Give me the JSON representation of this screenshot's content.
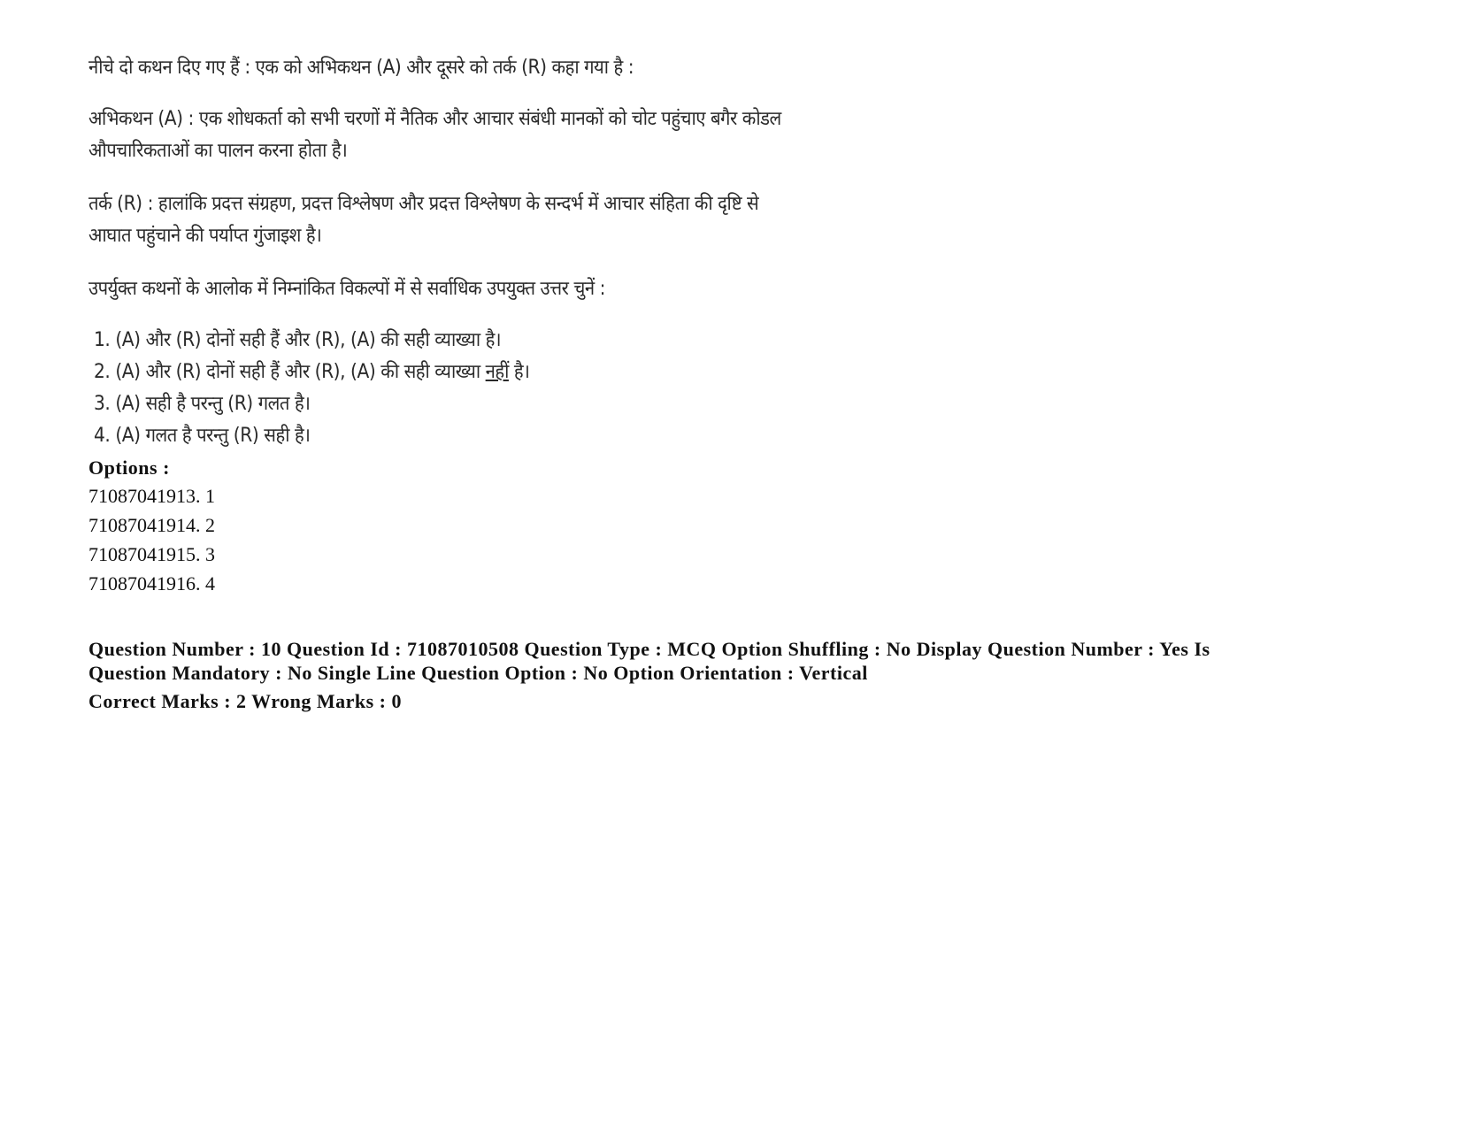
{
  "question": {
    "intro": "नीचे दो कथन दिए गए हैं : एक को अभिकथन (A) और दूसरे को तर्क (R) कहा गया है :",
    "assertion_line1": "अभिकथन (A) : एक शोधकर्ता को सभी चरणों में नैतिक और आचार संबंधी मानकों को चोट पहुंचाए बगैर कोडल",
    "assertion_line2": "औपचारिकताओं का पालन करना होता है।",
    "reason_line1": "तर्क (R) : हालांकि प्रदत्त संग्रहण, प्रदत्त विश्लेषण और प्रदत्त विश्लेषण के सन्दर्भ में आचार संहिता की दृष्टि से",
    "reason_line2": "आघात पहुंचाने की पर्याप्त गुंजाइश है।",
    "instruction": "उपर्युक्त कथनों के आलोक में निम्नांकित विकल्पों में से सर्वाधिक उपयुक्त उत्तर चुनें :",
    "choices": [
      {
        "text": "1. (A) और (R) दोनों सही हैं और (R), (A) की सही व्याख्या है।"
      },
      {
        "text_before": "2. (A) और (R) दोनों सही हैं और (R), (A) की सही व्याख्या ",
        "text_underlined": "नहीं",
        "text_after": " है।"
      },
      {
        "text": "3. (A) सही है परन्तु (R) गलत है।"
      },
      {
        "text": "4. (A) गलत  है परन्तु (R) सही है।"
      }
    ]
  },
  "options": {
    "heading": "Options :",
    "items": [
      {
        "label": "71087041913. 1"
      },
      {
        "label": "71087041914. 2"
      },
      {
        "label": "71087041915. 3"
      },
      {
        "label": "71087041916. 4"
      }
    ]
  },
  "meta": {
    "line1": "Question Number : 10 Question Id : 71087010508 Question Type : MCQ Option Shuffling : No Display Question Number : Yes Is",
    "line2": "Question Mandatory : No Single Line Question Option : No Option Orientation : Vertical",
    "line3": "Correct Marks : 2 Wrong Marks : 0"
  }
}
